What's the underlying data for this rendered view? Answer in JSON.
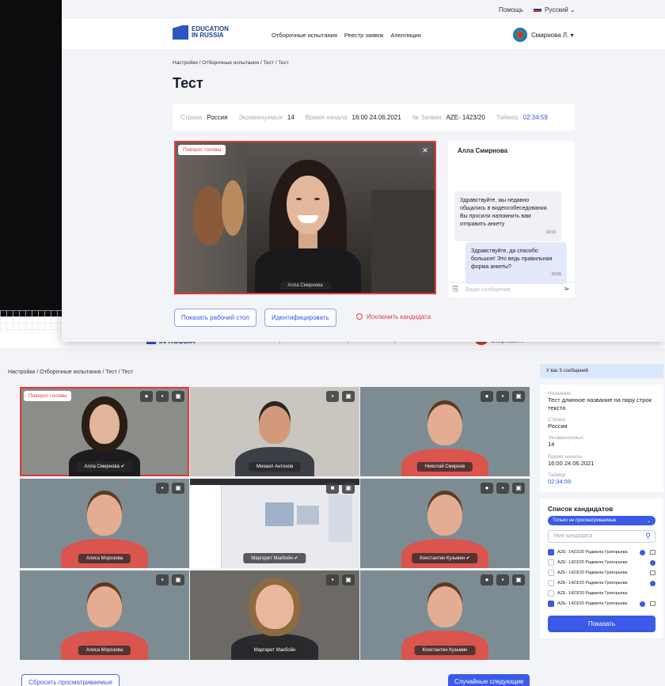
{
  "front": {
    "topbar": {
      "help": "Помощь",
      "lang": "Русский ⌄"
    },
    "logo": {
      "line1": "EDUCATION",
      "line2": "IN RUSSIA"
    },
    "nav": [
      "Отборочные испытания",
      "Реестр заявок",
      "Апелляции"
    ],
    "user": "Смирнова Л. ▾",
    "breadcrumb": "Настройки  /  Отборочные испытания  /  Тест  /  Тест",
    "title": "Тест",
    "stats": {
      "country_label": "Страна",
      "country": "Россия",
      "exam_label": "Экзаменуемых",
      "exam": "14",
      "start_label": "Время начала",
      "start": "16:00 24.06.2021",
      "app_label": "№ Заявки",
      "app": "AZE- 1423/20",
      "timer_label": "Таймер",
      "timer": "02:34:59"
    },
    "video": {
      "warning": "Поворот головы",
      "name": "Алла Смирнова",
      "close": "✕"
    },
    "buttons": {
      "desktop": "Показать рабочий стол",
      "identify": "Идентифицировать",
      "exclude": "Исключить кандидата"
    },
    "chat": {
      "name": "Алла Смирнова",
      "msg1": "Здравствуйте, мы недавно общались в видеособеседовании. Вы просили напомнить вам отправить анкету",
      "msg1_time": "16:53",
      "msg2": "Здравствуйте, да спасибо большое! Это ведь правильная форма анкеты?",
      "msg2_time": "16:55",
      "placeholder": "Ваше сообщение"
    }
  },
  "back": {
    "logo": "IN RUSSIA",
    "nav": "Отборочные испытания   Реестр заявок   Апелляции",
    "user": "Смирнова Л.",
    "breadcrumb": "Настройки  /  Отборочные испытания  /  Тест  /  Тест",
    "tiles": [
      {
        "name": "Алла Смирнова ✔",
        "warning": "Поворот головы"
      },
      {
        "name": "Михаил Антонов"
      },
      {
        "name": "Николай Смирнов"
      },
      {
        "name": "Алиса Морозова"
      },
      {
        "name": "Маргарет Макбойн ✔"
      },
      {
        "name": "Константин Кузьмин ✔"
      },
      {
        "name": "Алиса Морозова"
      },
      {
        "name": "Маргарет Макбойн"
      },
      {
        "name": "Константин Кузьмин"
      }
    ],
    "reset_button": "Сбросить просматриваемые",
    "random_button": "Случайные следующие",
    "messages_banner": "У вас 5 сообщений",
    "info": {
      "name_label": "Название",
      "name": "Тест длинное название на пару строк текста",
      "country_label": "Страна",
      "country": "Россия",
      "exam_label": "Экзаменуемых",
      "exam": "14",
      "start_label": "Время начала",
      "start": "16:00 24.06.2021",
      "timer_label": "Таймер",
      "timer": "02:34:59"
    },
    "candidates": {
      "title": "Список кандидатов",
      "filter": "Только не просматриваемые",
      "search_placeholder": "Имя кандидата",
      "rows": [
        {
          "text": "AZE- 1423/20  Радмила Григорьева",
          "checked": true
        },
        {
          "text": "AZE- 1423/20  Радмила Григорьева",
          "checked": false
        },
        {
          "text": "AZE- 1423/20  Радмила Григорьева",
          "checked": false
        },
        {
          "text": "AZE- 1423/20  Радмила Григорьева",
          "checked": false
        },
        {
          "text": "AZE- 1423/20  Радмила Григорьева",
          "checked": false
        },
        {
          "text": "AZE- 1423/20  Радмила Григорьева",
          "checked": true
        }
      ],
      "show_button": "Показать"
    }
  }
}
